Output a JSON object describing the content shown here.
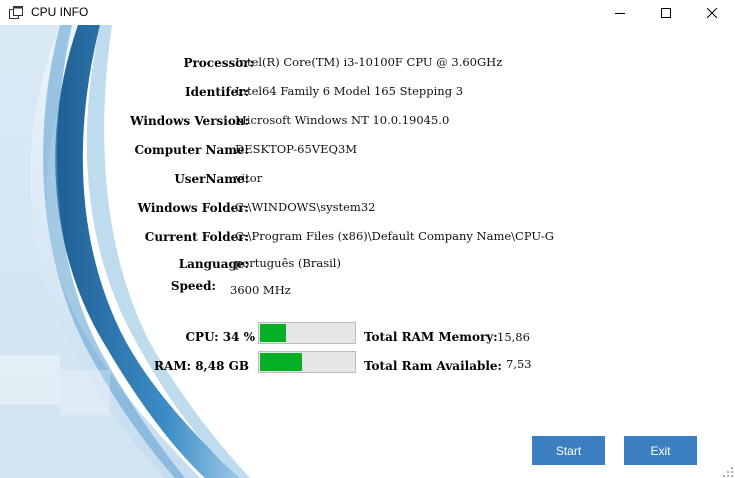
{
  "window": {
    "title": "CPU INFO"
  },
  "info": {
    "processor_label": "Processor:",
    "processor_value": "Intel(R) Core(TM) i3-10100F CPU @ 3.60GHz",
    "identifier_label": "Identifer:",
    "identifier_value": "Intel64 Family 6 Model 165 Stepping 3",
    "windows_version_label": "Windows Version:",
    "windows_version_value": "Microsoft Windows NT 10.0.19045.0",
    "computer_name_label": "Computer Name:",
    "computer_name_value": "DESKTOP-65VEQ3M",
    "username_label": "UserName:",
    "username_value": "vitor",
    "windows_folder_label": "Windows Folder:",
    "windows_folder_value": "C:\\WINDOWS\\system32",
    "current_folder_label": "Current Folder:",
    "current_folder_value": "C:\\Program Files (x86)\\Default Company Name\\CPU-G",
    "language_label": "Language:",
    "language_value": "português (Brasil)",
    "speed_label": "Speed:",
    "speed_value": "3600 MHz"
  },
  "usage": {
    "cpu_label": "CPU: 34 %",
    "cpu_fraction": 0.28,
    "ram_label": "RAM: 8,48 GB",
    "ram_fraction": 0.45,
    "total_ram_label": "Total RAM Memory:",
    "total_ram_value": "15,86",
    "ram_available_label": "Total Ram Available:",
    "ram_available_value": "7,53"
  },
  "buttons": {
    "start": "Start",
    "exit": "Exit"
  },
  "colors": {
    "progress_fill": "#06b025",
    "button_bg": "#3b7fc0",
    "decor_blue": "#2f6fa6"
  },
  "icons": {
    "app": "window-app-icon",
    "minimize": "minimize-icon",
    "maximize": "maximize-icon",
    "close": "close-icon"
  }
}
